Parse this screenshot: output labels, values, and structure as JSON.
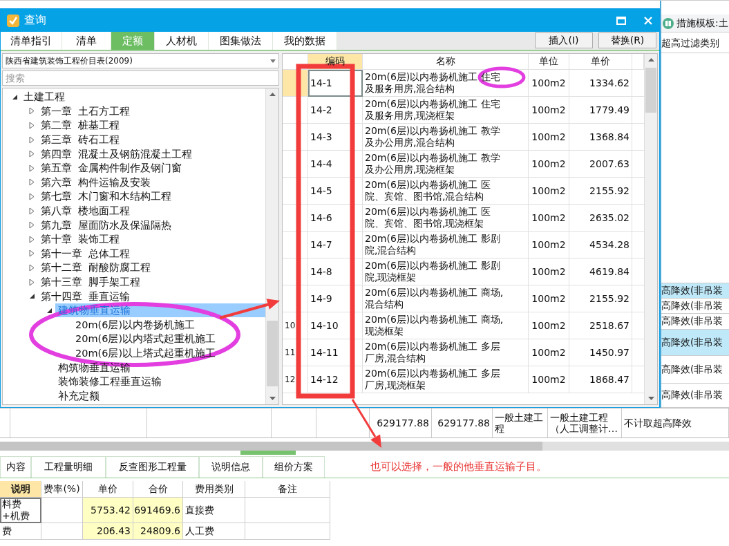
{
  "dialog": {
    "title": "查询",
    "tabs": [
      {
        "label": "清单指引",
        "selected": false
      },
      {
        "label": "清单",
        "selected": false
      },
      {
        "label": "定额",
        "selected": true
      },
      {
        "label": "人材机",
        "selected": false
      },
      {
        "label": "图集做法",
        "selected": false
      },
      {
        "label": "我的数据",
        "selected": false
      }
    ],
    "buttons": [
      "插入(I)",
      "替换(R)"
    ],
    "library_select": {
      "value": "陕西省建筑装饰工程价目表(2009)"
    },
    "search": {
      "placeholder": "搜索"
    },
    "tree": [
      {
        "label": "土建工程",
        "expanded": true,
        "selected": false,
        "children": [
          {
            "label": "第一章  土石方工程",
            "expanded": false,
            "selected": false
          },
          {
            "label": "第二章  桩基工程",
            "expanded": false,
            "selected": false
          },
          {
            "label": "第三章  砖石工程",
            "expanded": false,
            "selected": false
          },
          {
            "label": "第四章  混凝土及钢筋混凝土工程",
            "expanded": false,
            "selected": false
          },
          {
            "label": "第五章  金属构件制作及钢门窗",
            "expanded": false,
            "selected": false
          },
          {
            "label": "第六章  构件运输及安装",
            "expanded": false,
            "selected": false
          },
          {
            "label": "第七章  木门窗和木结构工程",
            "expanded": false,
            "selected": false
          },
          {
            "label": "第八章  楼地面工程",
            "expanded": false,
            "selected": false
          },
          {
            "label": "第九章  屋面防水及保温隔热",
            "expanded": false,
            "selected": false
          },
          {
            "label": "第十章  装饰工程",
            "expanded": false,
            "selected": false
          },
          {
            "label": "第十一章  总体工程",
            "expanded": false,
            "selected": false
          },
          {
            "label": "第十二章  耐酸防腐工程",
            "expanded": false,
            "selected": false
          },
          {
            "label": "第十三章  脚手架工程",
            "expanded": false,
            "selected": false
          },
          {
            "label": "第十四章  垂直运输",
            "expanded": true,
            "selected": false,
            "children": [
              {
                "label": "建筑物垂直运输",
                "expanded": true,
                "selected": true,
                "children": [
                  {
                    "label": "20m(6层)以内卷扬机施工",
                    "selected": false
                  },
                  {
                    "label": "20m(6层)以内塔式起重机施工",
                    "selected": false
                  },
                  {
                    "label": "20m(6层)以上塔式起重机施工",
                    "selected": false
                  }
                ]
              },
              {
                "label": "构筑物垂直运输",
                "selected": false
              },
              {
                "label": "装饰装修工程垂直运输",
                "selected": false
              },
              {
                "label": "补充定额",
                "selected": false
              }
            ]
          }
        ]
      }
    ],
    "table": {
      "columns": [
        "编码",
        "名称",
        "单位",
        "单价"
      ],
      "rows": [
        {
          "code": "14-1",
          "name": "20m(6层)以内卷扬机施工 住宅及服务用房,混合结构",
          "unit": "100m2",
          "price": "1334.62",
          "selected": true
        },
        {
          "code": "14-2",
          "name": "20m(6层)以内卷扬机施工 住宅及服务用房,现浇框架",
          "unit": "100m2",
          "price": "1779.49",
          "selected": false
        },
        {
          "code": "14-3",
          "name": "20m(6层)以内卷扬机施工 教学及办公用房,混合结构",
          "unit": "100m2",
          "price": "1368.84",
          "selected": false
        },
        {
          "code": "14-4",
          "name": "20m(6层)以内卷扬机施工 教学及办公用房,现浇框架",
          "unit": "100m2",
          "price": "2007.63",
          "selected": false
        },
        {
          "code": "14-5",
          "name": "20m(6层)以内卷扬机施工 医院、宾馆、图书馆,混合结构",
          "unit": "100m2",
          "price": "2155.92",
          "selected": false
        },
        {
          "code": "14-6",
          "name": "20m(6层)以内卷扬机施工 医院、宾馆、图书馆,现浇框架",
          "unit": "100m2",
          "price": "2635.02",
          "selected": false
        },
        {
          "code": "14-7",
          "name": "20m(6层)以内卷扬机施工 影剧院,混合结构",
          "unit": "100m2",
          "price": "4534.28",
          "selected": false
        },
        {
          "code": "14-8",
          "name": "20m(6层)以内卷扬机施工 影剧院,现浇框架",
          "unit": "100m2",
          "price": "4619.84",
          "selected": false
        },
        {
          "code": "14-9",
          "name": "20m(6层)以内卷扬机施工 商场,混合结构",
          "unit": "100m2",
          "price": "2155.92",
          "selected": false
        },
        {
          "row_number": "10",
          "code": "14-10",
          "name": "20m(6层)以内卷扬机施工 商场,现浇框架",
          "unit": "100m2",
          "price": "2518.67",
          "selected": false
        },
        {
          "row_number": "11",
          "code": "14-11",
          "name": "20m(6层)以内卷扬机施工 多层厂房,混合结构",
          "unit": "100m2",
          "price": "1450.97",
          "selected": false
        },
        {
          "row_number": "12",
          "code": "14-12",
          "name": "20m(6层)以内卷扬机施工 多层厂房,现浇框架",
          "unit": "100m2",
          "price": "1868.47",
          "selected": false
        }
      ]
    }
  },
  "side_panel": {
    "title": "措施模板:土",
    "filter_label": "超高过滤类别",
    "rows": [
      {
        "text": "高降效(非吊装",
        "highlighted": true
      },
      {
        "text": "高降效(非吊装",
        "highlighted": false
      },
      {
        "text": "高降效(非吊装",
        "highlighted": false
      },
      {
        "text": "高降效(非吊装",
        "highlighted": true
      },
      {
        "text": "高降效(非吊装",
        "highlighted": false
      },
      {
        "text": "高降效(非吊装",
        "highlighted": false
      }
    ]
  },
  "summary_row": [
    "629177.88",
    "629177.88",
    "一般土建工程",
    "一般土建工程（人工调整计…",
    "不计取超高降效"
  ],
  "bottom_tabs": [
    "内容",
    "工程量明细",
    "反查图形工程量",
    "说明信息",
    "组价方案"
  ],
  "note": "也可以选择，一般的他垂直运输子目。",
  "cost_table": {
    "columns": [
      "说明",
      "费率(%)",
      "单价",
      "合价",
      "费用类别",
      "备注"
    ],
    "rows": [
      {
        "description": "料费+机费",
        "rate": "",
        "unit_price": "5753.42",
        "total": "691469.6",
        "category": "直接费",
        "remark": ""
      },
      {
        "description": "费",
        "rate": "",
        "unit_price": "206.43",
        "total": "24809.6",
        "category": "人工费",
        "remark": ""
      }
    ]
  }
}
